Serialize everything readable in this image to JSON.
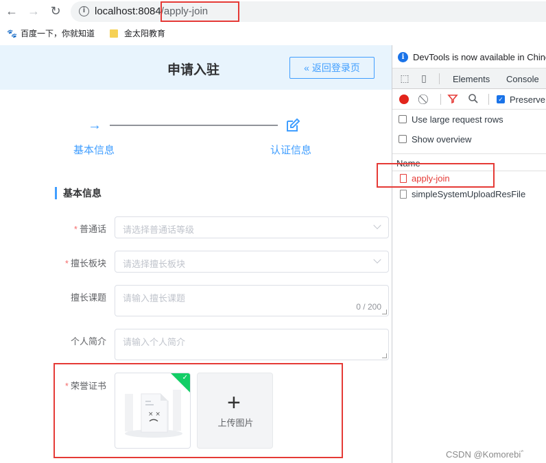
{
  "browser": {
    "url_host": "localhost:8084",
    "url_path": "/apply-join",
    "bookmarks": [
      {
        "label": "百度一下，你就知道",
        "icon": "baidu-paw-icon"
      },
      {
        "label": "金太阳教育",
        "icon": "folder-icon"
      }
    ]
  },
  "page": {
    "title": "申请入驻",
    "back_button": "« 返回登录页",
    "steps": [
      {
        "label": "基本信息",
        "icon": "arrow-right-icon"
      },
      {
        "label": "认证信息",
        "icon": "edit-icon"
      }
    ],
    "section_title": "基本信息",
    "form": {
      "mandarin": {
        "label": "普通话",
        "required": true,
        "placeholder": "请选择普通话等级"
      },
      "specialty": {
        "label": "擅长板块",
        "required": true,
        "placeholder": "请选择擅长板块"
      },
      "topic": {
        "label": "擅长课题",
        "required": false,
        "placeholder": "请输入擅长课题",
        "counter": "0 / 200"
      },
      "intro": {
        "label": "个人简介",
        "required": false,
        "placeholder": "请输入个人简介"
      },
      "certificate": {
        "label": "荣誉证书",
        "required": true,
        "upload_text": "上传图片",
        "plus": "+"
      }
    }
  },
  "devtools": {
    "banner": "DevTools is now available in Chinese!",
    "tabs": [
      "Elements",
      "Console"
    ],
    "preserve_log": "Preserve log",
    "options": [
      "Use large request rows",
      "Show overview"
    ],
    "column_name": "Name",
    "requests": [
      {
        "name": "apply-join",
        "status": "error"
      },
      {
        "name": "simpleSystemUploadResFile",
        "status": "ok"
      }
    ]
  },
  "watermark": "CSDN @Komorebi゛",
  "colors": {
    "accent": "#409eff",
    "error": "#e53935",
    "success": "#13ce66"
  }
}
